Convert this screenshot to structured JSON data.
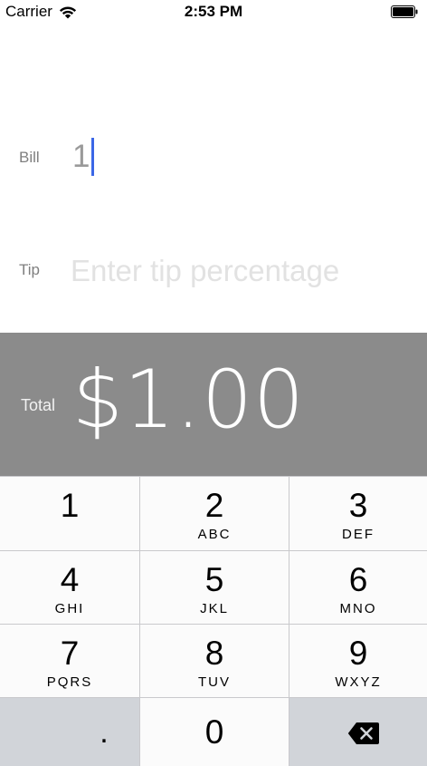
{
  "status_bar": {
    "carrier": "Carrier",
    "time": "2:53 PM"
  },
  "bill": {
    "label": "Bill",
    "value": "1"
  },
  "tip": {
    "label": "Tip",
    "placeholder": "Enter tip percentage",
    "value": ""
  },
  "total": {
    "label": "Total",
    "value": "$1.00"
  },
  "keypad": {
    "keys": [
      {
        "digit": "1",
        "letters": ""
      },
      {
        "digit": "2",
        "letters": "ABC"
      },
      {
        "digit": "3",
        "letters": "DEF"
      },
      {
        "digit": "4",
        "letters": "GHI"
      },
      {
        "digit": "5",
        "letters": "JKL"
      },
      {
        "digit": "6",
        "letters": "MNO"
      },
      {
        "digit": "7",
        "letters": "PQRS"
      },
      {
        "digit": "8",
        "letters": "TUV"
      },
      {
        "digit": "9",
        "letters": "WXYZ"
      },
      {
        "digit": ".",
        "letters": ""
      },
      {
        "digit": "0",
        "letters": ""
      },
      {
        "digit": "",
        "letters": "",
        "icon": "backspace-icon"
      }
    ]
  },
  "colors": {
    "accent_caret": "#3b67e6",
    "total_band": "#8b8b8b",
    "keypad_gray": "#d1d4d9"
  }
}
